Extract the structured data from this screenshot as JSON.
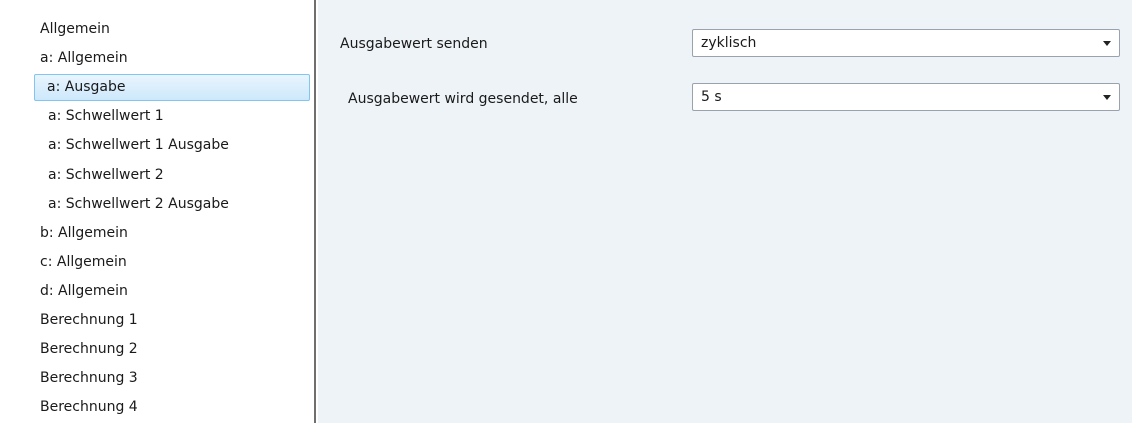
{
  "sidebar": {
    "items": [
      {
        "label": "Allgemein",
        "level": 0,
        "selected": false
      },
      {
        "label": "a: Allgemein",
        "level": 0,
        "selected": false
      },
      {
        "label": "a: Ausgabe",
        "level": 1,
        "selected": true
      },
      {
        "label": "a: Schwellwert 1",
        "level": 1,
        "selected": false
      },
      {
        "label": "a: Schwellwert 1 Ausgabe",
        "level": 1,
        "selected": false
      },
      {
        "label": "a: Schwellwert 2",
        "level": 1,
        "selected": false
      },
      {
        "label": "a: Schwellwert 2 Ausgabe",
        "level": 1,
        "selected": false
      },
      {
        "label": "b: Allgemein",
        "level": 0,
        "selected": false
      },
      {
        "label": "c: Allgemein",
        "level": 0,
        "selected": false
      },
      {
        "label": "d: Allgemein",
        "level": 0,
        "selected": false
      },
      {
        "label": "Berechnung 1",
        "level": 0,
        "selected": false
      },
      {
        "label": "Berechnung 2",
        "level": 0,
        "selected": false
      },
      {
        "label": "Berechnung 3",
        "level": 0,
        "selected": false
      },
      {
        "label": "Berechnung 4",
        "level": 0,
        "selected": false
      }
    ]
  },
  "params": [
    {
      "label": "Ausgabewert senden",
      "value": "zyklisch"
    },
    {
      "label": "Ausgabewert wird gesendet, alle",
      "value": "5 s"
    }
  ],
  "colors": {
    "content_bg": "#eef3f8",
    "selection_border": "#83c4f0",
    "splitter": "#6f6f6f"
  }
}
